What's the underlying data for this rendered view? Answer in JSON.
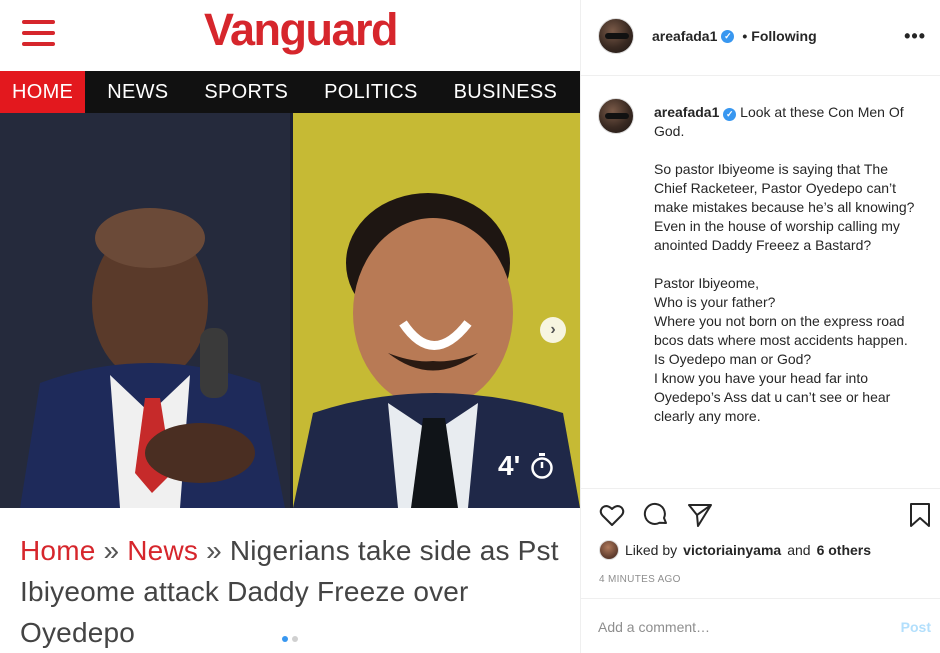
{
  "article": {
    "logo": "Vanguard",
    "nav": [
      {
        "label": "HOME",
        "active": true
      },
      {
        "label": "NEWS",
        "active": false
      },
      {
        "label": "SPORTS",
        "active": false
      },
      {
        "label": "POLITICS",
        "active": false
      },
      {
        "label": "BUSINESS",
        "active": false
      }
    ],
    "video_duration": "4'",
    "breadcrumb_home": "Home",
    "breadcrumb_sep": "»",
    "breadcrumb_news": "News",
    "headline": "Nigerians take side as Pst Ibiyeome attack Daddy Freeze over Oyedepo"
  },
  "post": {
    "username": "areafada1",
    "separator": "•",
    "follow_state": "Following",
    "more": "•••",
    "caption_username": "areafada1",
    "caption_text": "Look at these Con Men Of God.\n\nSo pastor Ibiyeome is saying that The Chief Racketeer, Pastor Oyedepo can’t make mistakes because he’s all knowing?\nEven in the house of worship calling my anointed Daddy Freeez a Bastard?\n\nPastor Ibiyeome,\nWho is your father?\nWhere you not born on the express road bcos dats where most accidents happen.\nIs Oyedepo man or God?\nI know you have your head far into Oyedepo’s Ass dat u can’t see or hear clearly any more.",
    "liked_prefix": "Liked by",
    "liked_user": "victoriainyama",
    "liked_and": "and",
    "liked_others": "6 others",
    "timestamp": "4 MINUTES AGO",
    "comment_placeholder": "Add a comment…",
    "post_label": "Post"
  },
  "colors": {
    "vanguard_red": "#d6262c",
    "nav_active": "#e3181e",
    "nav_bg": "#111111",
    "verified_blue": "#3897f0",
    "post_button": "#b2dffc"
  }
}
